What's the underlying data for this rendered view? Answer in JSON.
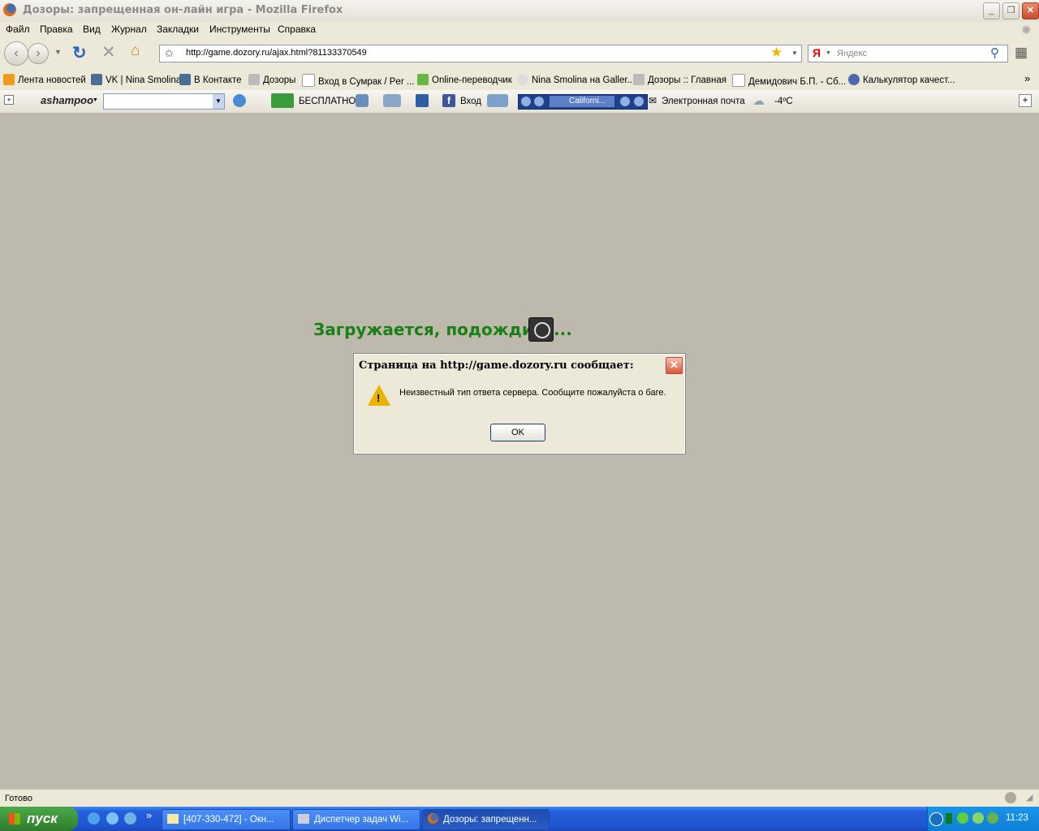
{
  "window": {
    "title": "Дозоры: запрещенная он-лайн игра - Mozilla Firefox"
  },
  "menu": [
    "Файл",
    "Правка",
    "Вид",
    "Журнал",
    "Закладки",
    "Инструменты",
    "Справка"
  ],
  "nav": {
    "url": "http://game.dozory.ru/ajax.html?81133370549",
    "search_engine": "Я",
    "search_placeholder": "Яндекс"
  },
  "bookmarks": [
    "Лента новостей",
    "VK | Nina Smolina",
    "В Контакте",
    "Дозоры",
    "Вход в Сумрак / Per ...",
    "Online-переводчик",
    "Nina Smolina на Galler...",
    "Дозоры :: Главная",
    "Демидович Б.П. - Сб...",
    "Калькулятор качест..."
  ],
  "toolbar2": {
    "brand": "ashampoo",
    "free": "БЕСПЛАТНО",
    "login": "Вход",
    "radio": "Californi...",
    "mail": "Электронная почта",
    "weather": "-4ºC"
  },
  "content": {
    "loading": "Загружается, подождите..."
  },
  "dialog": {
    "title": "Страница на http://game.dozory.ru сообщает:",
    "message": "Неизвестный тип ответа сервера. Сообщите пожалуйста о баге.",
    "ok": "OK"
  },
  "status": {
    "text": "Готово"
  },
  "taskbar": {
    "start": "пуск",
    "tasks": [
      "[407-330-472] - Окн...",
      "Диспетчер задач Wi...",
      "Дозоры: запрещенн..."
    ],
    "clock": "11:23"
  },
  "colors": {
    "accent_green": "#1a7f14",
    "xp_taskbar": "#245edb"
  }
}
